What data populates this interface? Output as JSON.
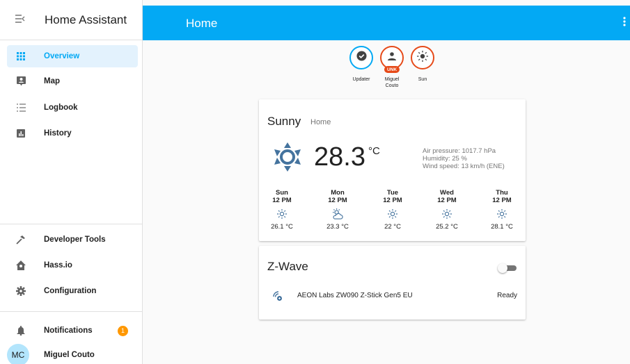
{
  "sidebar": {
    "title": "Home Assistant",
    "items": [
      {
        "label": "Overview",
        "icon": "view-grid-icon"
      },
      {
        "label": "Map",
        "icon": "map-account-icon"
      },
      {
        "label": "Logbook",
        "icon": "logbook-list-icon"
      },
      {
        "label": "History",
        "icon": "chart-bar-icon"
      }
    ],
    "tools": [
      {
        "label": "Developer Tools",
        "icon": "hammer-icon"
      },
      {
        "label": "Hass.io",
        "icon": "home-assistant-icon"
      },
      {
        "label": "Configuration",
        "icon": "gear-icon"
      }
    ],
    "notifications": {
      "label": "Notifications",
      "count": "1"
    },
    "user": {
      "initials": "MC",
      "name": "Miguel Couto"
    }
  },
  "header": {
    "title": "Home"
  },
  "entities": [
    {
      "name": "Updater",
      "icon": "check-circle-icon"
    },
    {
      "name": "Miguel Couto",
      "icon": "account-icon",
      "state": "UNK"
    },
    {
      "name": "Sun",
      "icon": "sun-icon"
    }
  ],
  "weather": {
    "condition": "Sunny",
    "location": "Home",
    "temperature": "28.3",
    "unit": "°C",
    "attributes": [
      "Air pressure: 1017.7 hPa",
      "Humidity: 25 %",
      "Wind speed: 13 km/h (ENE)"
    ],
    "forecast": [
      {
        "day": "Sun",
        "time": "12 PM",
        "temp": "26.1 °C",
        "icon": "sunny-icon"
      },
      {
        "day": "Mon",
        "time": "12 PM",
        "temp": "23.3 °C",
        "icon": "partly-cloudy-icon"
      },
      {
        "day": "Tue",
        "time": "12 PM",
        "temp": "22 °C",
        "icon": "sunny-icon"
      },
      {
        "day": "Wed",
        "time": "12 PM",
        "temp": "25.2 °C",
        "icon": "sunny-icon"
      },
      {
        "day": "Thu",
        "time": "12 PM",
        "temp": "28.1 °C",
        "icon": "sunny-icon"
      }
    ]
  },
  "zwave": {
    "title": "Z-Wave",
    "device": {
      "name": "AEON Labs ZW090 Z-Stick Gen5 EU",
      "state": "Ready"
    }
  },
  "colors": {
    "primary": "#03a9f4",
    "accent": "#ff9800",
    "unknown": "#e64a19",
    "weather_icon": "#44739e"
  }
}
